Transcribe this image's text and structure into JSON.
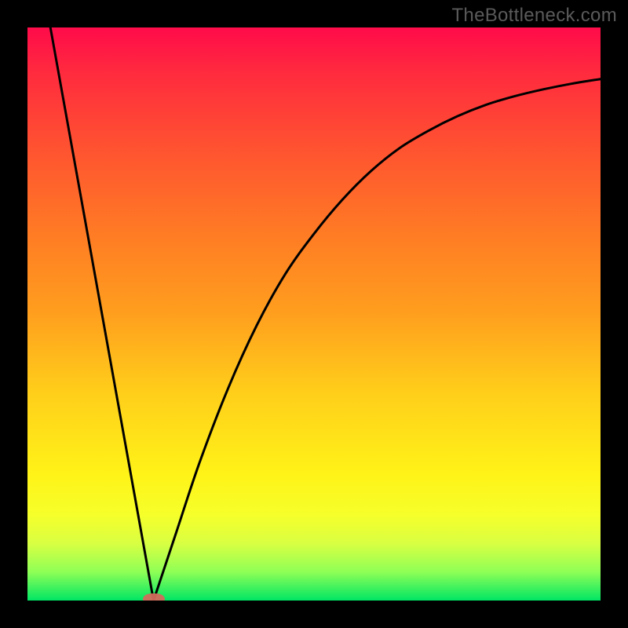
{
  "watermark": "TheBottleneck.com",
  "colors": {
    "frame": "#000000",
    "curve": "#000000",
    "dot": "#d46a5c",
    "gradient_stops": [
      "#ff0b4a",
      "#ff2b3e",
      "#ff5530",
      "#ff7b24",
      "#ff9f1e",
      "#ffcf1a",
      "#fff318",
      "#f6ff2a",
      "#d9ff42",
      "#8fff56",
      "#00e664"
    ]
  },
  "chart_data": {
    "type": "line",
    "title": "",
    "xlabel": "",
    "ylabel": "",
    "xlim": [
      0,
      100
    ],
    "ylim": [
      0,
      100
    ],
    "annotations": [
      {
        "name": "minimum-marker",
        "x": 22,
        "y": 0
      }
    ],
    "series": [
      {
        "name": "left-branch",
        "shape": "linear",
        "x": [
          4,
          22
        ],
        "y": [
          100,
          0
        ]
      },
      {
        "name": "right-branch",
        "shape": "concave-asymptotic",
        "x": [
          22,
          26,
          30,
          35,
          40,
          45,
          50,
          55,
          60,
          65,
          70,
          75,
          80,
          85,
          90,
          95,
          100
        ],
        "y": [
          0,
          12,
          24,
          37,
          48,
          57,
          64,
          70,
          75,
          79,
          82,
          84.5,
          86.5,
          88,
          89.2,
          90.2,
          91
        ]
      }
    ]
  }
}
